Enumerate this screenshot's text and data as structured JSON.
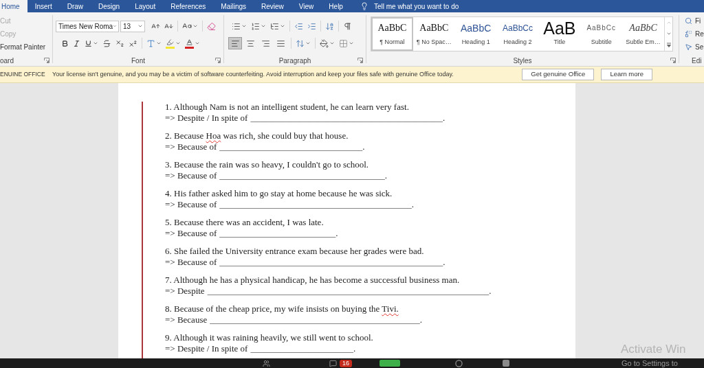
{
  "tabs": [
    {
      "label": "Home",
      "selected": true
    },
    {
      "label": "Insert",
      "selected": false
    },
    {
      "label": "Draw",
      "selected": false
    },
    {
      "label": "Design",
      "selected": false
    },
    {
      "label": "Layout",
      "selected": false
    },
    {
      "label": "References",
      "selected": false
    },
    {
      "label": "Mailings",
      "selected": false
    },
    {
      "label": "Review",
      "selected": false
    },
    {
      "label": "View",
      "selected": false
    },
    {
      "label": "Help",
      "selected": false
    }
  ],
  "tell_me": {
    "placeholder": "Tell me what you want to do"
  },
  "clipboard": {
    "items": [
      {
        "label": "Cut",
        "disabled": true
      },
      {
        "label": "Copy",
        "disabled": true
      },
      {
        "label": "Format Painter",
        "disabled": false
      }
    ],
    "label": "oard"
  },
  "font": {
    "font_name": "Times New Roma",
    "font_size": "13",
    "label": "Font"
  },
  "paragraph": {
    "alignment": [
      {
        "kind": "left",
        "selected": true
      },
      {
        "kind": "center",
        "selected": false
      },
      {
        "kind": "right",
        "selected": false
      },
      {
        "kind": "justify",
        "selected": false
      }
    ],
    "label": "Paragraph"
  },
  "styles": {
    "items": [
      {
        "kind": "normal",
        "preview": "AaBbC",
        "name": "¶ Normal",
        "selected": true
      },
      {
        "kind": "no_spacing",
        "preview": "AaBbC",
        "name": "¶ No Spac…",
        "selected": false
      },
      {
        "kind": "heading1",
        "preview": "AaBbC",
        "name": "Heading 1",
        "selected": false
      },
      {
        "kind": "heading2",
        "preview": "AaBbCc",
        "name": "Heading 2",
        "selected": false
      },
      {
        "kind": "title",
        "preview": "AaB",
        "name": "Title",
        "selected": false
      },
      {
        "kind": "subtitle",
        "preview": "AaBbCc",
        "name": "Subtitle",
        "selected": false
      },
      {
        "kind": "subtle_emphasis",
        "preview": "AaBbC",
        "name": "Subtle Em…",
        "selected": false
      }
    ],
    "label": "Styles"
  },
  "editing": {
    "items": [
      {
        "kind": "find",
        "label": "Fi"
      },
      {
        "kind": "replace",
        "label": "Re"
      },
      {
        "kind": "select",
        "label": "Se"
      }
    ],
    "label": "Edi"
  },
  "license_notice": {
    "title": "ENUINE OFFICE",
    "message": "Your license isn't genuine, and you may be a victim of software counterfeiting. Avoid interruption and keep your files safe with genuine Office today.",
    "buttons": [
      "Get genuine Office",
      "Learn more"
    ]
  },
  "document": {
    "exercises": [
      {
        "runs": [
          {
            "text": "1. Although Nam is not an intelligent student, he can learn very fast.",
            "misspelled": false
          }
        ],
        "prompt": "=> Despite / In spite of",
        "blank": "___________________________________________",
        "end": "."
      },
      {
        "runs": [
          {
            "text": "2. Because ",
            "misspelled": false
          },
          {
            "text": "Hoa",
            "misspelled": true
          },
          {
            "text": " was rich, she could buy that house.",
            "misspelled": false
          }
        ],
        "prompt": "=> Because of",
        "blank": "________________________________",
        "end": "."
      },
      {
        "runs": [
          {
            "text": "3. Because the rain was so heavy, I couldn't go to school.",
            "misspelled": false
          }
        ],
        "prompt": "=> Because of",
        "blank": "_____________________________________",
        "end": "."
      },
      {
        "runs": [
          {
            "text": "4. His father asked him to go stay at home because he was sick.",
            "misspelled": false
          }
        ],
        "prompt": "=> Because of",
        "blank": "___________________________________________",
        "end": "."
      },
      {
        "runs": [
          {
            "text": "5. Because there was an accident, I was late.",
            "misspelled": false
          }
        ],
        "prompt": "=> Because of",
        "blank": "__________________________",
        "end": "."
      },
      {
        "runs": [
          {
            "text": "6. She failed the University entrance exam because her grades were bad.",
            "misspelled": false
          }
        ],
        "prompt": "=> Because of",
        "blank": "__________________________________________________",
        "end": "."
      },
      {
        "runs": [
          {
            "text": "7. Although he has a physical handicap, he has become a successful business man.",
            "misspelled": false
          }
        ],
        "prompt": "=> Despite",
        "blank": "_______________________________________________________________",
        "end": "."
      },
      {
        "runs": [
          {
            "text": "8. Because of the cheap price, my wife insists on buying the ",
            "misspelled": false
          },
          {
            "text": "Tivi.",
            "misspelled": true
          }
        ],
        "prompt": "=> Because",
        "blank": "_______________________________________________",
        "end": "."
      },
      {
        "runs": [
          {
            "text": "9. Although it was raining heavily, we still went to school.",
            "misspelled": false
          }
        ],
        "prompt": "=> Despite / In spite of",
        "blank": "_______________________",
        "end": "."
      }
    ]
  },
  "activation": {
    "title": "Activate Win",
    "hint": "Go to Settings to"
  },
  "taskbar": {
    "badge": "16"
  }
}
